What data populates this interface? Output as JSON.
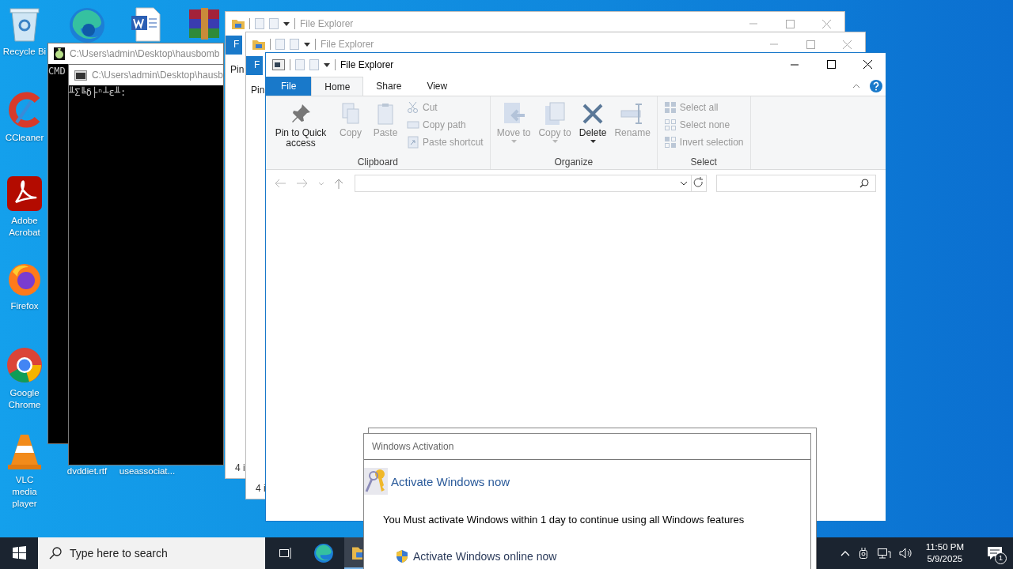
{
  "desktop_icons": [
    {
      "kind": "recycle",
      "label": "Recycle Bi"
    },
    {
      "kind": "edge"
    },
    {
      "kind": "word"
    },
    {
      "kind": "winrar"
    },
    {
      "kind": "ccleaner",
      "label": "CCleaner"
    },
    {
      "kind": "acrobat",
      "label": "Adobe Acrobat"
    },
    {
      "kind": "firefox",
      "label": "Firefox"
    },
    {
      "kind": "chrome",
      "label": "Google Chrome"
    },
    {
      "kind": "vlc",
      "label": "VLC media player"
    },
    {
      "kind": "file",
      "label": "dvddiet.rtf"
    },
    {
      "kind": "file",
      "label": "useassociat..."
    }
  ],
  "explorer_windows_behind": [
    {
      "title": "File Explorer",
      "file_tab": "F",
      "command": "Pin",
      "status": "4 i"
    },
    {
      "title": "File Explorer",
      "file_tab": "F",
      "command": "Pin",
      "status": "4 i"
    }
  ],
  "cmd_windows": [
    {
      "title": "C:\\Users\\admin\\Desktop\\hausbomb",
      "text": "CMD"
    },
    {
      "title": "C:\\Users\\admin\\Desktop\\hausb",
      "text": "╨Σ╚δ├ⁿ┴ε╨:"
    }
  ],
  "explorer": {
    "title": "File Explorer",
    "file_menu": "File",
    "tabs": [
      {
        "label": "Home",
        "selected": true
      },
      {
        "label": "Share",
        "selected": false
      },
      {
        "label": "View",
        "selected": false
      }
    ],
    "groups": [
      {
        "label": "Clipboard",
        "commands": [
          {
            "label": "Pin to Quick access",
            "kind": "pin",
            "disabled": false
          },
          {
            "label": "Copy",
            "kind": "copy",
            "disabled": true
          },
          {
            "label": "Paste",
            "kind": "paste",
            "disabled": true
          }
        ],
        "small_commands": [
          {
            "label": "Cut",
            "kind": "cut",
            "disabled": true
          },
          {
            "label": "Copy path",
            "kind": "copypath",
            "disabled": true
          },
          {
            "label": "Paste shortcut",
            "kind": "shortcut",
            "disabled": true
          }
        ]
      },
      {
        "label": "Organize",
        "commands": [
          {
            "label": "Move to",
            "kind": "move",
            "disabled": true,
            "dropdown": true
          },
          {
            "label": "Copy to",
            "kind": "copyto",
            "disabled": true,
            "dropdown": true
          },
          {
            "label": "Delete",
            "kind": "delete",
            "disabled": false,
            "dropdown": true
          },
          {
            "label": "Rename",
            "kind": "rename",
            "disabled": true,
            "dropdown": false
          }
        ]
      },
      {
        "label": "Select",
        "small_commands": [
          {
            "label": "Select all",
            "kind": "selall",
            "disabled": true
          },
          {
            "label": "Select none",
            "kind": "selnone",
            "disabled": true
          },
          {
            "label": "Invert selection",
            "kind": "invert",
            "disabled": true
          }
        ]
      }
    ]
  },
  "activation": {
    "title": "Windows Activation",
    "heading": "Activate Windows now",
    "message": "You Must activate Windows within 1 day to continue using all Windows features",
    "link": "Activate Windows online now"
  },
  "taskbar": {
    "search": {
      "placeholder": "Type here to search"
    },
    "apps": [
      {
        "kind": "taskview",
        "active": false
      },
      {
        "kind": "edge",
        "active": false
      },
      {
        "kind": "explorer",
        "active": true
      }
    ],
    "time": "11:50 PM",
    "date": "5/9/2025",
    "notifications": "1"
  }
}
